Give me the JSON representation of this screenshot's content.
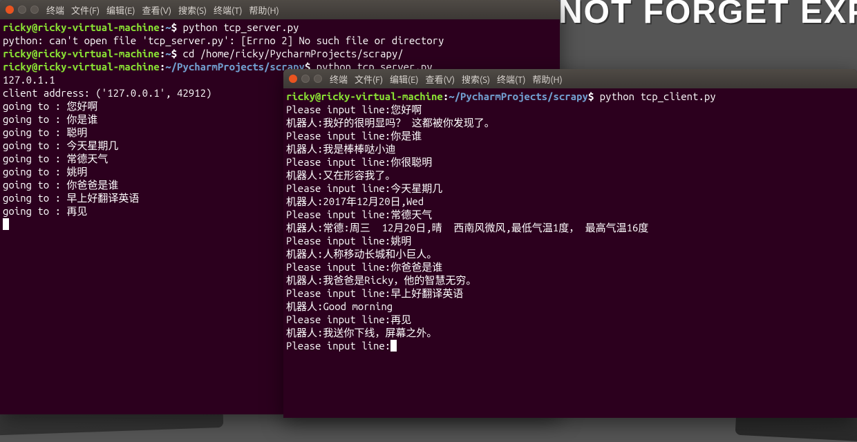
{
  "bg_text": "E DO NOT FORGET EXP",
  "menu": {
    "terminal": "终端",
    "file": "文件(F)",
    "edit": "编辑(E)",
    "view": "查看(V)",
    "search": "搜索(S)",
    "terminal2": "终端(T)",
    "help": "帮助(H)"
  },
  "prompt": {
    "user_host": "ricky@ricky-virtual-machine",
    "home": "~",
    "project_path": "~/PycharmProjects/scrapy",
    "dollar": "$"
  },
  "term1": {
    "cmd1": "python tcp_server.py",
    "err": "python: can't open file 'tcp_server.py': [Errno 2] No such file or directory",
    "cmd2": "cd /home/ricky/PycharmProjects/scrapy/",
    "cmd3": "python tcp_server.py",
    "out_ip": "127.0.1.1",
    "out_client": "client address: ('127.0.0.1', 42912)",
    "going_prefix": "going to : ",
    "going": [
      "您好啊",
      "你是谁",
      "聪明",
      "今天星期几",
      "常德天气",
      "姚明",
      "你爸爸是谁",
      "早上好翻译英语",
      "再见"
    ]
  },
  "term2": {
    "cmd1": "python tcp_client.py",
    "input_prefix": "Please input line:",
    "bot_prefix": "机器人:",
    "dialog": [
      {
        "in": "您好啊",
        "out": "我好的很明显吗？ 这都被你发现了。"
      },
      {
        "in": "你是谁",
        "out": "我是棒棒哒小迪"
      },
      {
        "in": "你很聪明",
        "out": "又在形容我了。"
      },
      {
        "in": "今天星期几",
        "out": "2017年12月20日,Wed"
      },
      {
        "in": "常德天气",
        "out": "常德:周三  12月20日,晴  西南风微风,最低气温1度， 最高气温16度"
      },
      {
        "in": "姚明",
        "out": "人称移动长城和小巨人。"
      },
      {
        "in": "你爸爸是谁",
        "out": "我爸爸是Ricky，他的智慧无穷。"
      },
      {
        "in": "早上好翻译英语",
        "out": "Good morning"
      },
      {
        "in": "再见",
        "out": "我送你下线，屏幕之外。"
      }
    ]
  }
}
